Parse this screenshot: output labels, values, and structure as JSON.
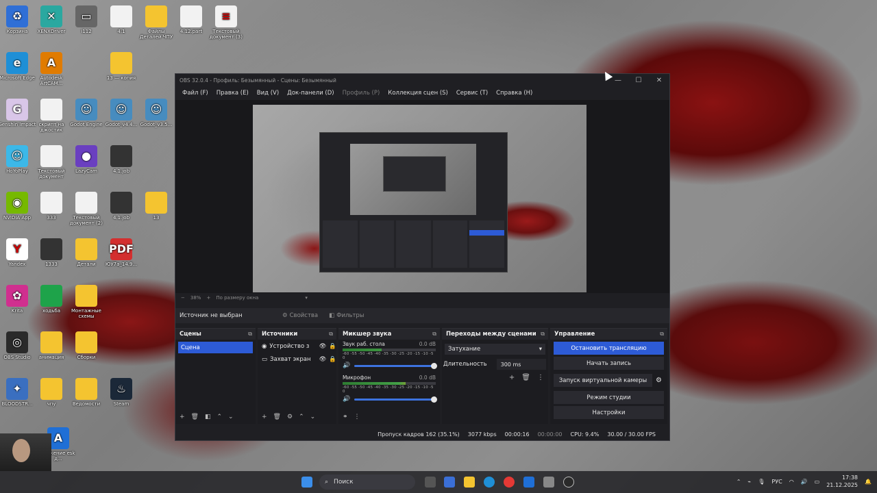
{
  "desktop": {
    "icons": [
      {
        "label": "Корзина",
        "color": "#2f6fd6",
        "glyph": "♻"
      },
      {
        "label": "XENXDriver",
        "color": "#2aa8a0",
        "glyph": "✕"
      },
      {
        "label": "i112",
        "color": "#666666",
        "glyph": "▭"
      },
      {
        "label": "4.1",
        "color": "#f2f2f2",
        "glyph": ""
      },
      {
        "label": "Файлы Деталей ЧПУ",
        "color": "#f4c430",
        "glyph": ""
      },
      {
        "label": "4.12.part",
        "color": "#f2f2f2",
        "glyph": ""
      },
      {
        "label": "Текстовый документ (3)",
        "color": "#f2f2f2",
        "glyph": "≡"
      },
      {
        "label": "Microsoft Edge",
        "color": "#1f8fd6",
        "glyph": "e"
      },
      {
        "label": "Autodesk ArtCAM...",
        "color": "#e07b00",
        "glyph": "A"
      },
      {
        "label": "13 — копия",
        "color": "#f4c430",
        "glyph": ""
      },
      {
        "label": "Genshin Impact",
        "color": "#d9c6e8",
        "glyph": "G"
      },
      {
        "label": "скрипт на джостик",
        "color": "#f2f2f2",
        "glyph": ""
      },
      {
        "label": "Godot Engine",
        "color": "#478cbf",
        "glyph": "☺"
      },
      {
        "label": "Godot_v4.4...",
        "color": "#478cbf",
        "glyph": "☺"
      },
      {
        "label": "Godot_v3.5...",
        "color": "#478cbf",
        "glyph": "☺"
      },
      {
        "label": "HoYoPlay",
        "color": "#3cb8e8",
        "glyph": "☺"
      },
      {
        "label": "Текстовый документ",
        "color": "#f2f2f2",
        "glyph": ""
      },
      {
        "label": "LazyCam",
        "color": "#6a3fc0",
        "glyph": "●"
      },
      {
        "label": "4.1.job",
        "color": "#333333",
        "glyph": ""
      },
      {
        "label": "NVIDIA App",
        "color": "#76b900",
        "glyph": "◉"
      },
      {
        "label": "333",
        "color": "#f2f2f2",
        "glyph": ""
      },
      {
        "label": "Текстовый документ (2)",
        "color": "#f2f2f2",
        "glyph": ""
      },
      {
        "label": "4.1.job",
        "color": "#333333",
        "glyph": ""
      },
      {
        "label": "13",
        "color": "#f4c430",
        "glyph": ""
      },
      {
        "label": "Yandex",
        "color": "#ffffff",
        "glyph": "Y"
      },
      {
        "label": "1333",
        "color": "#333333",
        "glyph": ""
      },
      {
        "label": "Детали",
        "color": "#f4c430",
        "glyph": ""
      },
      {
        "label": "ЮУ7а_14.9...",
        "color": "#d32f2f",
        "glyph": "PDF"
      },
      {
        "label": "Krita",
        "color": "#d02f8f",
        "glyph": "✿"
      },
      {
        "label": "ходьба",
        "color": "#1ea34a",
        "glyph": ""
      },
      {
        "label": "Монтажные схемы",
        "color": "#f4c430",
        "glyph": ""
      },
      {
        "label": "OBS Studio",
        "color": "#2a2a2a",
        "glyph": "◎"
      },
      {
        "label": "анимация",
        "color": "#f4c430",
        "glyph": ""
      },
      {
        "label": "Сборки",
        "color": "#f4c430",
        "glyph": ""
      },
      {
        "label": "BLOODSTR...",
        "color": "#3a6fc0",
        "glyph": "✦"
      },
      {
        "label": "чпу",
        "color": "#f4c430",
        "glyph": ""
      },
      {
        "label": "Ведомости",
        "color": "#f4c430",
        "glyph": ""
      },
      {
        "label": "Steam",
        "color": "#1b2838",
        "glyph": "♨"
      },
      {
        "label": "...ожение esk д...",
        "color": "#1f6fd6",
        "glyph": "A"
      }
    ]
  },
  "obs": {
    "title": "OBS 32.0.4 - Профиль: Безымянный - Сцены: Безымянный",
    "menu": [
      "Файл (F)",
      "Правка (E)",
      "Вид (V)",
      "Док-панели (D)",
      "Профиль (P)",
      "Коллекция сцен (S)",
      "Сервис (T)",
      "Справка (H)"
    ],
    "preview_toolbar": {
      "zoom": "38%",
      "fit": "По размеру окна"
    },
    "context_bar": {
      "source": "Источник не выбран",
      "properties": "Свойства",
      "filters": "Фильтры"
    },
    "scenes": {
      "title": "Сцены",
      "items": [
        "Сцена"
      ]
    },
    "sources": {
      "title": "Источники",
      "items": [
        "Устройство з",
        "Захват экран"
      ]
    },
    "mixer": {
      "title": "Микшер звука",
      "channels": [
        {
          "name": "Звук раб. стола",
          "db": "0.0 dB",
          "level": 0.42
        },
        {
          "name": "Микрофон",
          "db": "0.0 dB",
          "level": 0.68
        }
      ],
      "ticks": "-60 -55 -50 -45 -40 -35 -30 -25 -20 -15 -10 -5 0"
    },
    "transitions": {
      "title": "Переходы между сценами",
      "selected": "Затухание",
      "duration_label": "Длительность",
      "duration": "300 ms"
    },
    "controls": {
      "title": "Управление",
      "stop_stream": "Остановить трансляцию",
      "start_record": "Начать запись",
      "virtual_cam": "Запуск виртуальной камеры",
      "studio_mode": "Режим студии",
      "settings": "Настройки"
    },
    "status": {
      "dropped": "Пропуск кадров 162 (35.1%)",
      "bitrate": "3077 kbps",
      "stream_time": "00:00:16",
      "rec_time": "00:00:00",
      "cpu": "CPU: 9.4%",
      "fps": "30.00 / 30.00 FPS"
    }
  },
  "taskbar": {
    "search": "Поиск",
    "lang": "РУС",
    "time": "17:38",
    "date": "21.12.2025"
  }
}
